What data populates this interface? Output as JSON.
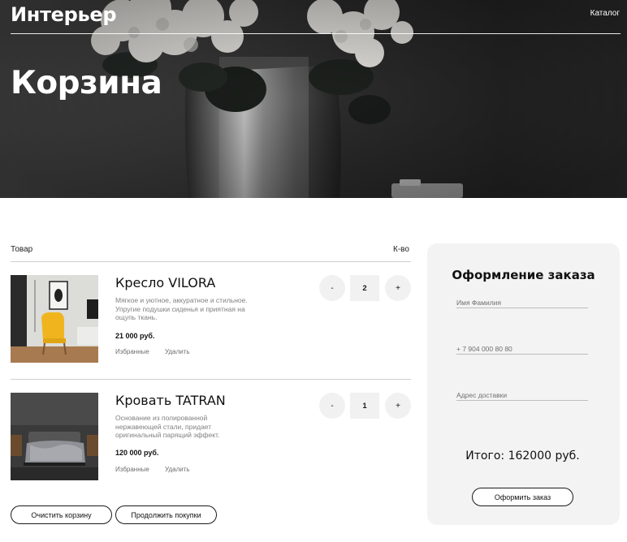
{
  "header": {
    "brand": "Интерьер",
    "nav_catalog": "Каталог",
    "page_title": "Корзина"
  },
  "cart": {
    "col_product": "Товар",
    "col_qty": "К-во",
    "items": [
      {
        "name": "Кресло VILORA",
        "description": "Мягкое и уютное, аккуратное и стильное. Упругие подушки сиденья и приятная на ощупь ткань.",
        "price": "21 000 руб.",
        "favorite": "Избранные",
        "remove": "Удалить",
        "qty": "2",
        "minus": "-",
        "plus": "+"
      },
      {
        "name": "Кровать TATRAN",
        "description": "Основание из полированной нержавеющей стали, придает оригинальный парящий эффект.",
        "price": "120 000 руб.",
        "favorite": "Избранные",
        "remove": "Удалить",
        "qty": "1",
        "minus": "-",
        "plus": "+"
      }
    ],
    "clear_button": "Очистить корзину",
    "continue_button": "Продолжить покупки"
  },
  "order": {
    "title": "Оформление заказа",
    "name_placeholder": "Имя Фамилия",
    "phone_placeholder": "+ 7 904 000 80 80",
    "address_placeholder": "Адрес доставки",
    "total": "Итого: 162000 руб.",
    "submit": "Оформить заказ"
  },
  "colors": {
    "accent_chair": "#f0b51e",
    "panel_bg": "#f3f3f3",
    "qty_bg": "#f1f1f1"
  }
}
